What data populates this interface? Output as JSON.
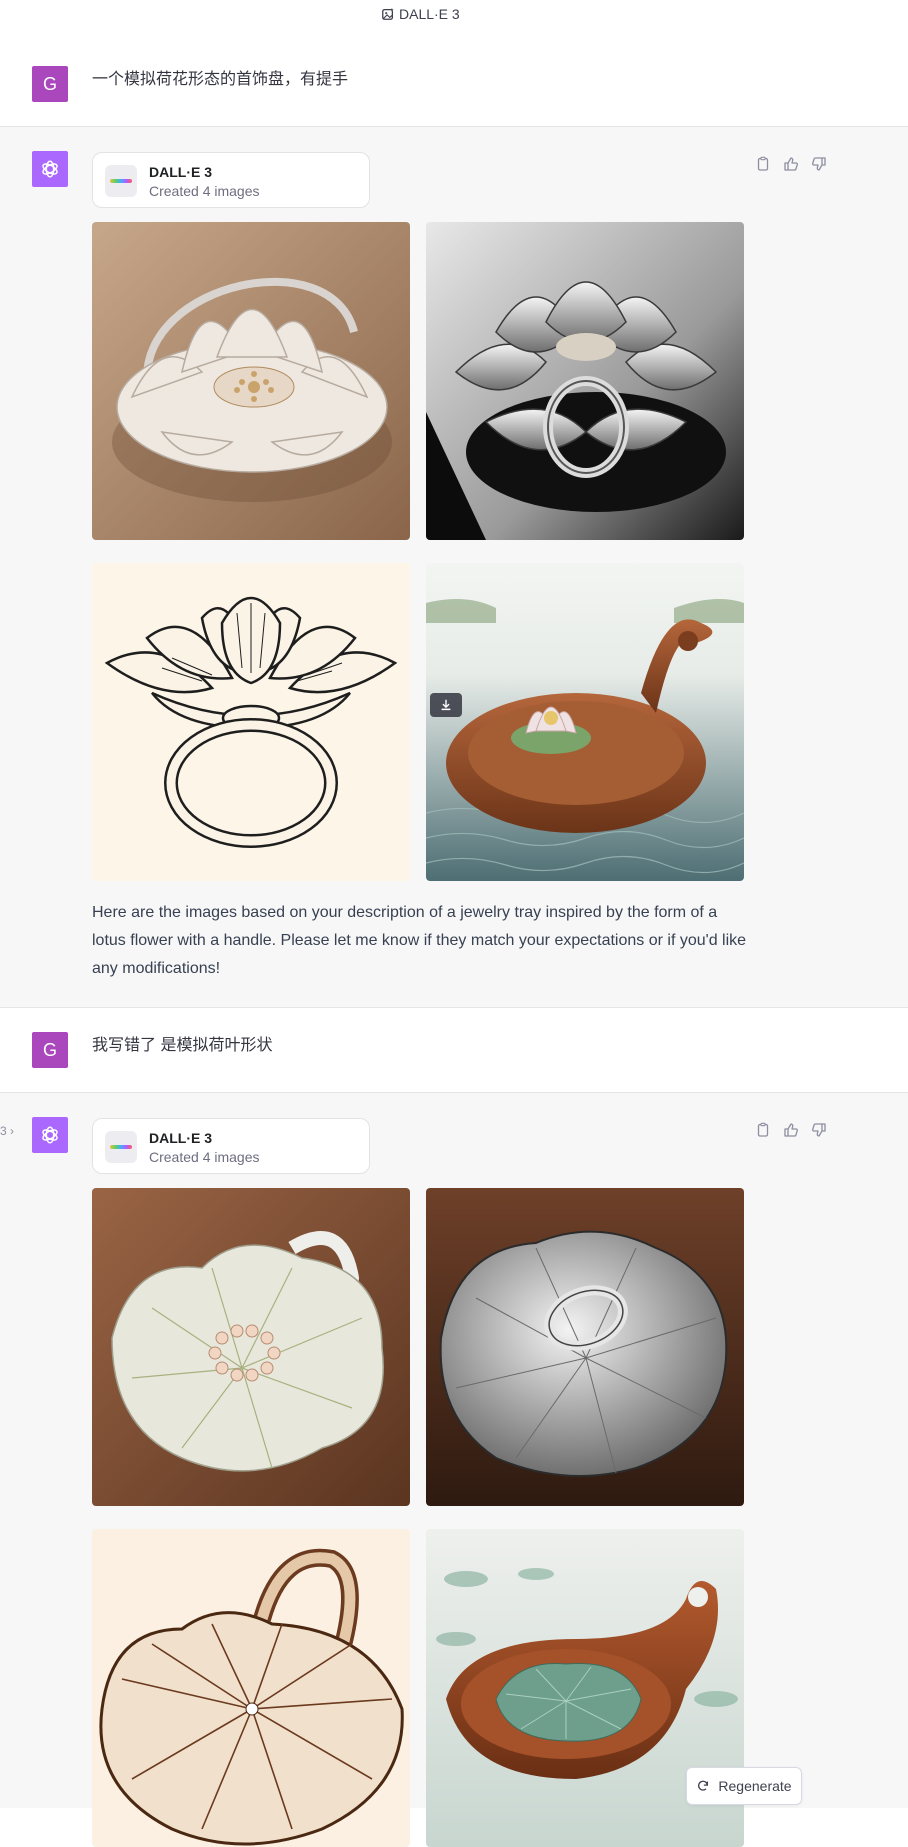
{
  "header": {
    "title": "DALL·E 3"
  },
  "messages": {
    "user1": {
      "avatar": "G",
      "text": "一个模拟荷花形态的首饰盘，有提手"
    },
    "assistant1": {
      "tool_name": "DALL·E 3",
      "tool_status": "Created 4 images",
      "response": "Here are the images based on your description of a jewelry tray inspired by the form of a lotus flower with a handle. Please let me know if they match your expectations or if you'd like any modifications!"
    },
    "user2": {
      "avatar": "G",
      "text": "我写错了 是模拟荷叶形状"
    },
    "assistant2": {
      "tool_name": "DALL·E 3",
      "tool_status": "Created 4 images",
      "side_marker": "3 ›"
    }
  },
  "buttons": {
    "regenerate": "Regenerate"
  },
  "icons": {
    "header": "image-sparkle-icon",
    "copy": "clipboard-icon",
    "like": "thumbs-up-icon",
    "dislike": "thumbs-down-icon",
    "download": "download-icon",
    "regenerate": "refresh-icon"
  },
  "colors": {
    "user_avatar": "#ab47bc",
    "gpt_avatar": "#ab68ff",
    "assistant_bg": "#f7f7f8"
  }
}
